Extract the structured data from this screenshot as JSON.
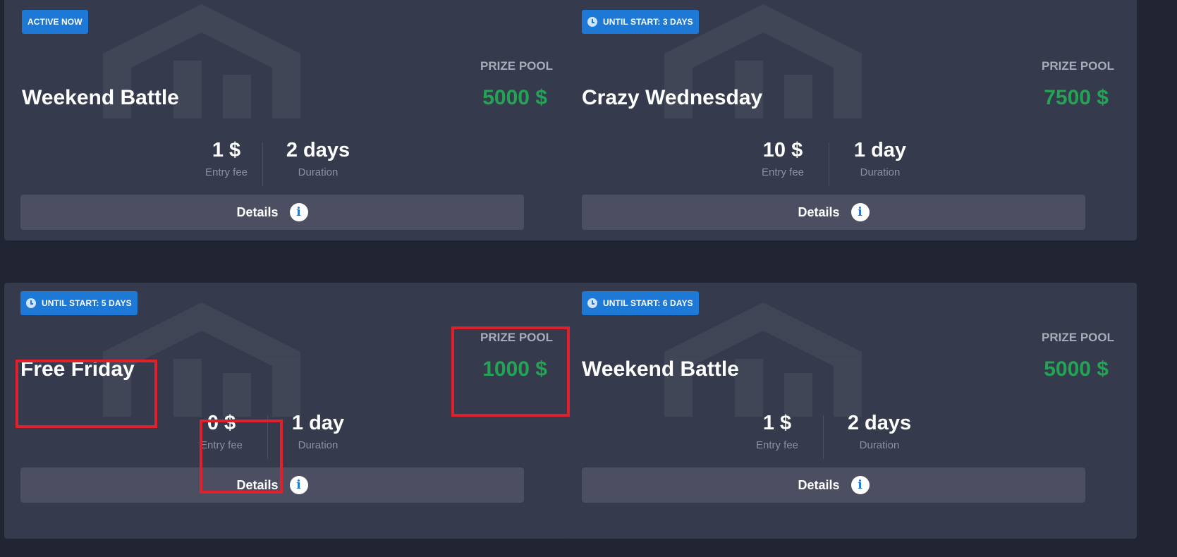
{
  "cards": [
    {
      "badge": "ACTIVE NOW",
      "badge_has_clock": false,
      "title": "Weekend Battle",
      "prize_label": "PRIZE POOL",
      "prize_value": "5000 $",
      "entry_fee": "1 $",
      "entry_fee_label": "Entry fee",
      "duration": "2 days",
      "duration_label": "Duration",
      "details_label": "Details"
    },
    {
      "badge": "UNTIL START: 3 DAYS",
      "badge_has_clock": true,
      "title": "Crazy Wednesday",
      "prize_label": "PRIZE POOL",
      "prize_value": "7500 $",
      "entry_fee": "10 $",
      "entry_fee_label": "Entry fee",
      "duration": "1 day",
      "duration_label": "Duration",
      "details_label": "Details"
    },
    {
      "badge": "UNTIL START: 5 DAYS",
      "badge_has_clock": true,
      "title": "Free Friday",
      "prize_label": "PRIZE POOL",
      "prize_value": "1000 $",
      "entry_fee": "0 $",
      "entry_fee_label": "Entry fee",
      "duration": "1 day",
      "duration_label": "Duration",
      "details_label": "Details"
    },
    {
      "badge": "UNTIL START: 6 DAYS",
      "badge_has_clock": true,
      "title": "Weekend Battle",
      "prize_label": "PRIZE POOL",
      "prize_value": "5000 $",
      "entry_fee": "1 $",
      "entry_fee_label": "Entry fee",
      "duration": "2 days",
      "duration_label": "Duration",
      "details_label": "Details"
    }
  ],
  "info_icon": "info-icon",
  "clock_icon": "clock-icon",
  "colors": {
    "background": "#212533",
    "card": "#353a4c",
    "badge": "#1e78d6",
    "prize": "#23a455",
    "details_button": "#4b4f61",
    "highlight": "#e0202a"
  }
}
